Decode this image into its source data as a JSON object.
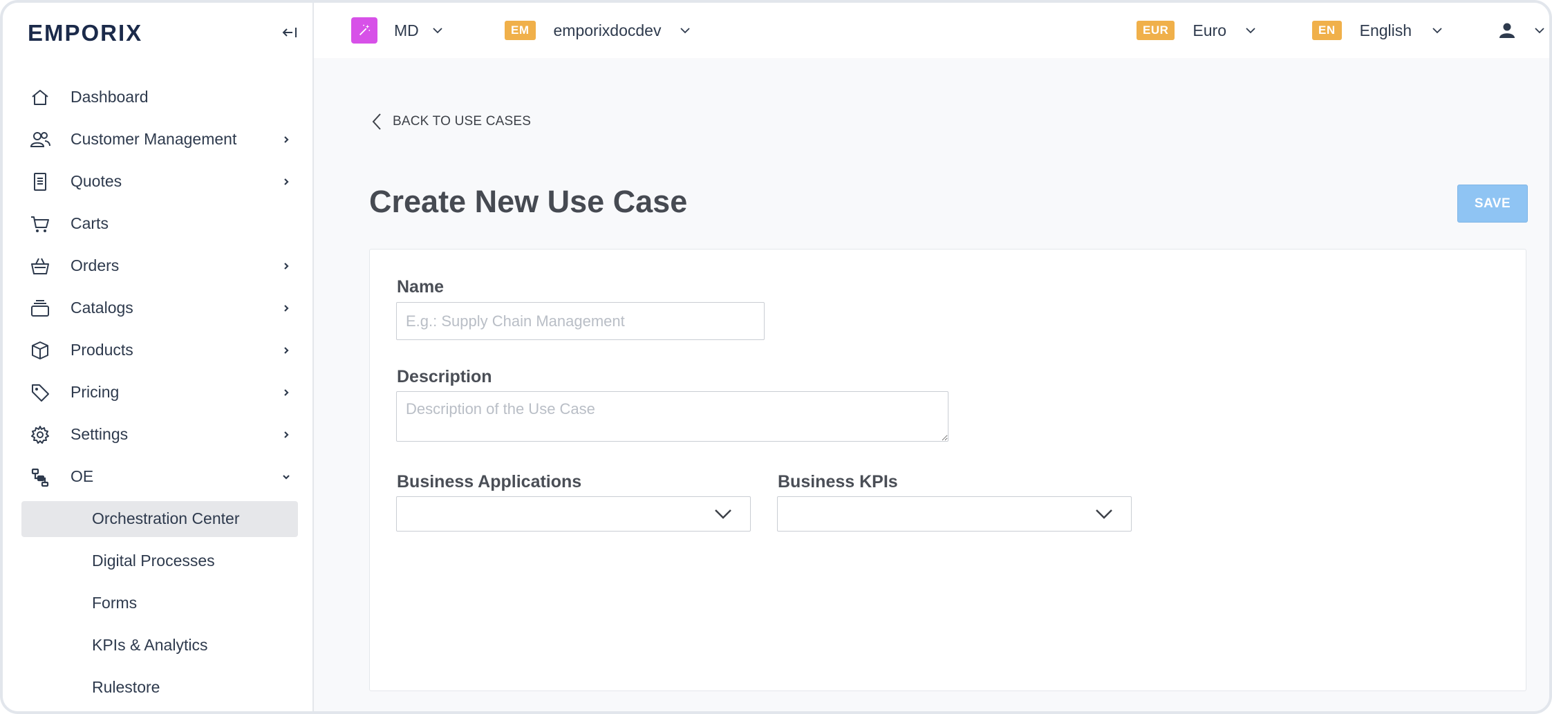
{
  "brand": {
    "logo_text": "emporix"
  },
  "sidebar": {
    "items": [
      {
        "label": "Dashboard",
        "icon": "home-icon",
        "has_children": false
      },
      {
        "label": "Customer Management",
        "icon": "users-icon",
        "has_children": true
      },
      {
        "label": "Quotes",
        "icon": "document-icon",
        "has_children": true
      },
      {
        "label": "Carts",
        "icon": "cart-icon",
        "has_children": false
      },
      {
        "label": "Orders",
        "icon": "basket-icon",
        "has_children": true
      },
      {
        "label": "Catalogs",
        "icon": "layers-icon",
        "has_children": true
      },
      {
        "label": "Products",
        "icon": "box-icon",
        "has_children": true
      },
      {
        "label": "Pricing",
        "icon": "tag-icon",
        "has_children": true
      },
      {
        "label": "Settings",
        "icon": "gear-icon",
        "has_children": true
      },
      {
        "label": "OE",
        "icon": "workflow-icon",
        "has_children": true,
        "expanded": true
      }
    ],
    "oe_children": [
      {
        "label": "Orchestration Center",
        "active": true
      },
      {
        "label": "Digital Processes",
        "active": false
      },
      {
        "label": "Forms",
        "active": false
      },
      {
        "label": "KPIs & Analytics",
        "active": false
      },
      {
        "label": "Rulestore",
        "active": false
      }
    ]
  },
  "topbar": {
    "site": {
      "label": "MD",
      "icon": "magic-wand-icon",
      "icon_color": "#d751e8"
    },
    "tenant": {
      "badge": "EM",
      "label": "emporixdocdev"
    },
    "currency": {
      "badge": "EUR",
      "label": "Euro"
    },
    "language": {
      "badge": "EN",
      "label": "English"
    },
    "user": {
      "icon": "user-icon"
    },
    "badge_color": "#f0b04a"
  },
  "page": {
    "back_label": "BACK TO USE CASES",
    "title": "Create New Use Case",
    "save_label": "SAVE",
    "save_color": "#8fc4f3"
  },
  "form": {
    "name": {
      "label": "Name",
      "value": "",
      "placeholder": "E.g.: Supply Chain Management"
    },
    "description": {
      "label": "Description",
      "value": "",
      "placeholder": "Description of the Use Case"
    },
    "business_applications": {
      "label": "Business Applications",
      "value": ""
    },
    "business_kpis": {
      "label": "Business KPIs",
      "value": ""
    }
  }
}
